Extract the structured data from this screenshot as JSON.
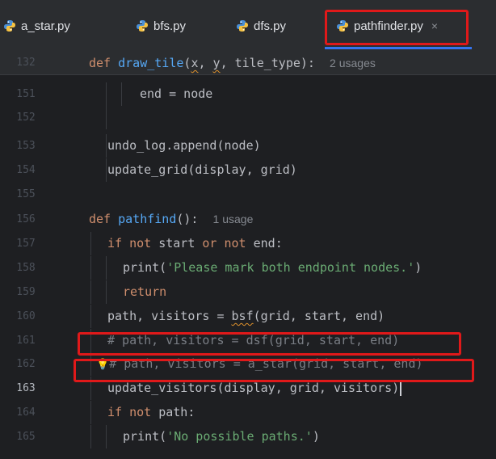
{
  "colors": {
    "editor_bg": "#1e1f22",
    "keyword": "#cf8e6d",
    "function": "#56a8f5",
    "string": "#6aab73",
    "comment": "#7a7e85",
    "highlight_box": "#e0191a",
    "active_tab_underline": "#3574f0"
  },
  "tabs": [
    {
      "label": "a_star.py",
      "icon": "python-file-icon"
    },
    {
      "label": "bfs.py",
      "icon": "python-file-icon"
    },
    {
      "label": "dfs.py",
      "icon": "python-file-icon"
    },
    {
      "label": "pathfinder.py",
      "icon": "python-file-icon",
      "active": true,
      "close": "×"
    }
  ],
  "sticky_header": {
    "line_number": "132",
    "kw": "def",
    "name": "draw_tile",
    "params": [
      "(",
      "x",
      ", ",
      "y",
      ", tile_type):"
    ],
    "usage": "2 usages"
  },
  "lines": {
    "l151": {
      "num": "151",
      "text": "end = node"
    },
    "l152": {
      "num": "152"
    },
    "l153": {
      "num": "153",
      "text": "undo_log.append(node)"
    },
    "l154": {
      "num": "154",
      "text": "update_grid(display, grid)"
    },
    "l155": {
      "num": "155"
    },
    "l156": {
      "num": "156",
      "kw": "def",
      "name": "pathfind",
      "rest": "():",
      "usage": "1 usage"
    },
    "l157": {
      "num": "157",
      "kw1": "if not",
      "mid1": " start ",
      "kw2": "or not",
      "mid2": " end:"
    },
    "l158": {
      "num": "158",
      "pre": "print(",
      "str": "'Please mark both endpoint nodes.'",
      "post": ")"
    },
    "l159": {
      "num": "159",
      "kw": "return"
    },
    "l160": {
      "num": "160",
      "pre": "path, visitors = ",
      "squig": "bsf",
      "post": "(grid, start, end)"
    },
    "l161": {
      "num": "161",
      "comment": "# path, visitors = dsf(grid, start, end)"
    },
    "l162": {
      "num": "162",
      "bulb": "💡",
      "comment": "# path, visitors = a_star(grid, start, end)"
    },
    "l163": {
      "num": "163",
      "text": "update_visitors(display, grid, visitors)"
    },
    "l164": {
      "num": "164",
      "kw": "if not",
      "post": " path:"
    },
    "l165": {
      "num": "165",
      "pre": "print(",
      "str": "'No possible paths.'",
      "post": ")"
    }
  }
}
